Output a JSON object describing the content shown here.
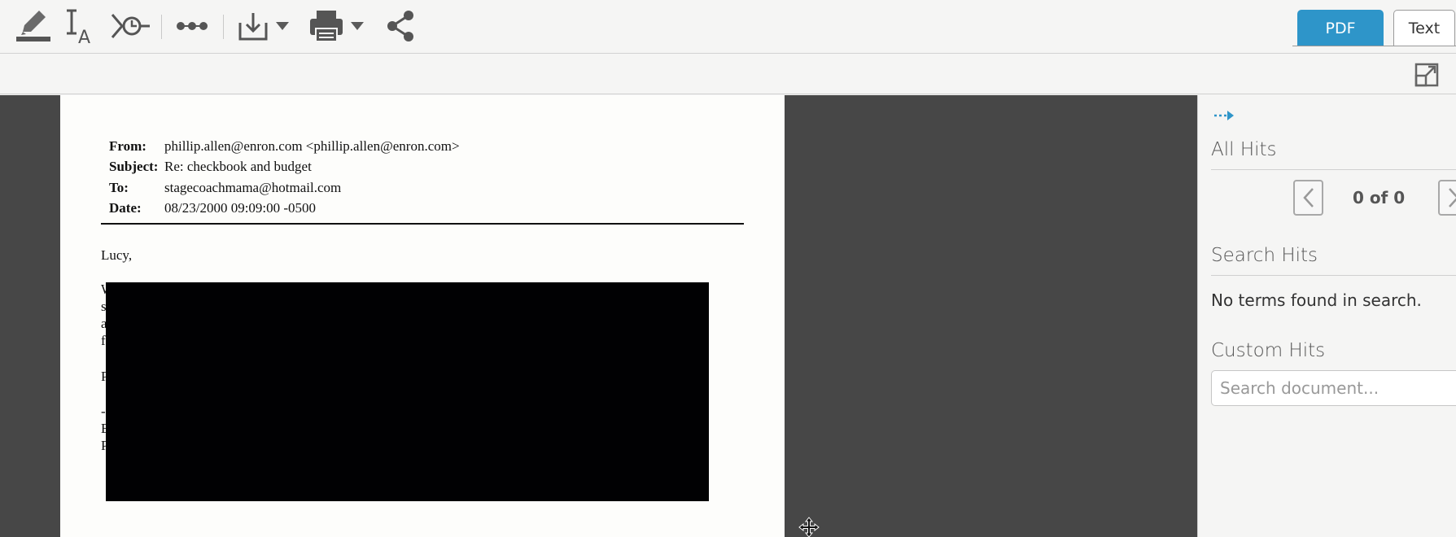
{
  "toolbar": {
    "icons": [
      "highlighter-icon",
      "text-select-icon",
      "redline-icon",
      "more-icon",
      "download-icon",
      "print-icon",
      "share-icon"
    ]
  },
  "view_tabs": {
    "pdf_label": "PDF",
    "text_label": "Text"
  },
  "email": {
    "from_label": "From:",
    "from_value": "phillip.allen@enron.com <phillip.allen@enron.com>",
    "subject_label": "Subject:",
    "subject_value": "Re: checkbook and budget",
    "to_label": "To:",
    "to_value": "stagecoachmama@hotmail.com",
    "date_label": "Date:",
    "date_value": "08/23/2000 09:09:00 -0500",
    "greeting": "Lucy,",
    "visible_fragments": [
      "W",
      "s",
      "a",
      "f",
      "P",
      "-",
      "E",
      "P"
    ]
  },
  "side_panel": {
    "all_hits_title": "All Hits",
    "hit_count": "0 of 0",
    "search_hits_title": "Search Hits",
    "no_terms_message": "No terms found in search.",
    "custom_hits_title": "Custom Hits",
    "search_placeholder": "Search document..."
  },
  "colors": {
    "accent": "#2e95c9",
    "doc_background": "#474747",
    "redaction": "#010103"
  }
}
